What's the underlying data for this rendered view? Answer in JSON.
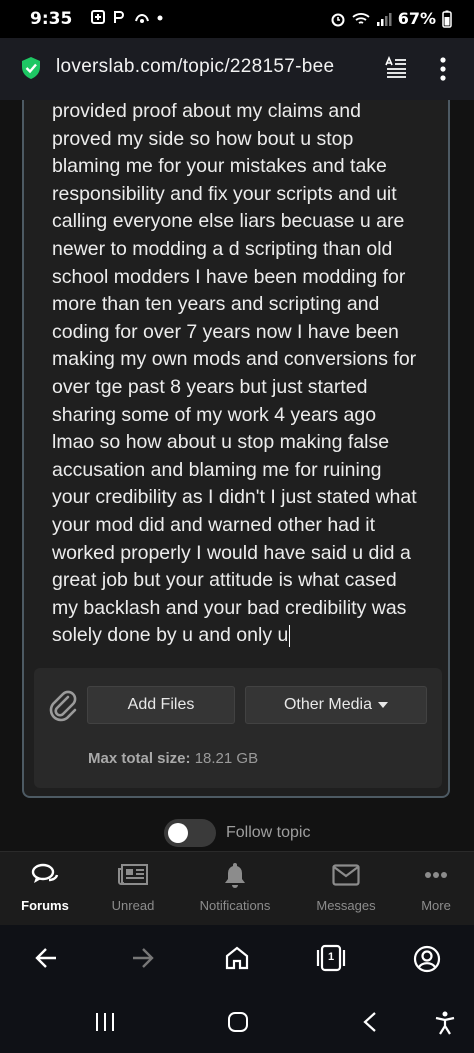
{
  "status_bar": {
    "time": "9:35",
    "battery": "67%"
  },
  "url_bar": {
    "url": "loverslab.com/topic/228157-bee"
  },
  "editor": {
    "text_lines": [
      "provided proof about my claims and",
      "proved my side so how bout u stop",
      "blaming me for your mistakes and take",
      "responsibility and fix your scripts and uit",
      "calling everyone else liars becuase u are",
      "newer to modding a d scripting than old",
      "school modders I have been modding for",
      "more than ten years and scripting and",
      "coding for over 7 years now I have been",
      "making my own mods and conversions for",
      "over tge past 8 years but just started",
      "sharing some of my work 4 years ago",
      "lmao so how about u stop making false",
      "accusation and blaming me for ruining",
      "your credibility as I didn't I just stated what",
      "your mod did and warned other had it",
      "worked properly I would have said u did a",
      "great job but your attitude is what cased",
      "my backlash and your bad credibility was",
      "solely done by u and only u"
    ]
  },
  "attachments": {
    "add_files_label": "Add Files",
    "other_media_label": "Other Media",
    "max_size_label": "Max total size:",
    "max_size_value": "18.21 GB"
  },
  "follow": {
    "label": "Follow topic",
    "enabled": false
  },
  "bottom_nav": {
    "items": [
      {
        "label": "Forums",
        "icon": "forums-icon",
        "active": true
      },
      {
        "label": "Unread",
        "icon": "newspaper-icon",
        "active": false
      },
      {
        "label": "Notifications",
        "icon": "bell-icon",
        "active": false
      },
      {
        "label": "Messages",
        "icon": "envelope-icon",
        "active": false
      },
      {
        "label": "More",
        "icon": "more-dots-icon",
        "active": false
      }
    ]
  },
  "browser_toolbar": {
    "tab_count": "1"
  }
}
